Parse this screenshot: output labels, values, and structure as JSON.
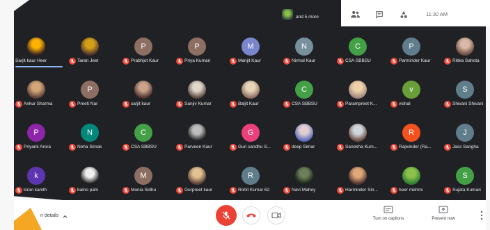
{
  "top_bar": {
    "speakers_summary": "and 5 more",
    "speaker_thumbnail_colors": [
      "#8bc34a",
      "#263238"
    ],
    "clock": "11:30 AM",
    "icons": {
      "participants": "people-icon",
      "chat": "chat-icon",
      "activities": "activities-icon"
    }
  },
  "participants": [
    {
      "name": "Sarjit kaur Heer",
      "photo": [
        "#ffb300",
        "#3e2723"
      ],
      "muted": false,
      "highlighted": true
    },
    {
      "name": "Taran Jeet",
      "photo": [
        "#d4a017",
        "#4e342e"
      ],
      "muted": true
    },
    {
      "name": "Prabhjot Kaur",
      "initial": "P",
      "color": "#8d6e63",
      "muted": true
    },
    {
      "name": "Priya Kumari",
      "initial": "P",
      "color": "#8d6e63",
      "muted": true
    },
    {
      "name": "Manjit Kaur",
      "initial": "M",
      "color": "#7986cb",
      "muted": true
    },
    {
      "name": "Nirmal Kaur",
      "initial": "N",
      "color": "#78909c",
      "muted": true
    },
    {
      "name": "CSA SBBSU",
      "initial": "C",
      "color": "#43a047",
      "muted": true
    },
    {
      "name": "Parminder Kaur",
      "initial": "P",
      "color": "#607d8b",
      "muted": true
    },
    {
      "name": "Ritika Sahota",
      "photo": [
        "#d7b9a7",
        "#6d4c41"
      ],
      "muted": true
    },
    {
      "name": "Ankur Sharma",
      "photo": [
        "#d2a679",
        "#5d4037"
      ],
      "muted": true
    },
    {
      "name": "Preeti Nar",
      "initial": "P",
      "color": "#8d6e63",
      "muted": true
    },
    {
      "name": "sarjit kaur",
      "photo": [
        "#c9a38b",
        "#4e342e"
      ],
      "muted": true
    },
    {
      "name": "Sanjiv Kumar",
      "photo": [
        "#e0d6cc",
        "#5d4b40"
      ],
      "muted": true
    },
    {
      "name": "Baljit Kaur",
      "photo": [
        "#e6d5b8",
        "#8d6e63"
      ],
      "muted": true
    },
    {
      "name": "CSA SBBSU",
      "initial": "C",
      "color": "#43a047",
      "muted": true
    },
    {
      "name": "Parampreet K...",
      "photo": [
        "#f0d2a8",
        "#a1887f"
      ],
      "muted": true
    },
    {
      "name": "vishal",
      "initial": "v",
      "color": "#689f38",
      "muted": true
    },
    {
      "name": "Shivani Shivani",
      "initial": "S",
      "color": "#607d8b",
      "muted": true
    },
    {
      "name": "Priyank Arora",
      "initial": "P",
      "color": "#8e24aa",
      "muted": true
    },
    {
      "name": "Neha Simak",
      "initial": "N",
      "color": "#00897b",
      "muted": true
    },
    {
      "name": "CSA SBBSU",
      "initial": "C",
      "color": "#43a047",
      "muted": true
    },
    {
      "name": "Parveen Kaur",
      "photo": [
        "#bdbdbd",
        "#212121"
      ],
      "muted": true
    },
    {
      "name": "Guri sandhu S...",
      "initial": "G",
      "color": "#ec407a",
      "muted": true
    },
    {
      "name": "deep Simar",
      "photo": [
        "#e0cfcf",
        "#5c6bc0"
      ],
      "muted": true
    },
    {
      "name": "Sanekha Kum...",
      "photo": [
        "#cfd8dc",
        "#6d4c41"
      ],
      "muted": true
    },
    {
      "name": "Rajwinder (Ra...",
      "initial": "R",
      "color": "#f4511e",
      "muted": true
    },
    {
      "name": "Jass Sangha",
      "initial": "J",
      "color": "#607d8b",
      "muted": true
    },
    {
      "name": "kiran kanith",
      "initial": "k",
      "color": "#5e35b1",
      "muted": true
    },
    {
      "name": "balno pahi",
      "photo": [
        "#eeeeee",
        "#1b1b1b"
      ],
      "muted": true
    },
    {
      "name": "Monia Sidhu",
      "initial": "M",
      "color": "#8d6e63",
      "muted": true
    },
    {
      "name": "Gurpreet kaur",
      "photo": [
        "#e2c290",
        "#5d4037"
      ],
      "muted": true
    },
    {
      "name": "Rohit Kumar 62",
      "initial": "R",
      "color": "#607d8b",
      "muted": true
    },
    {
      "name": "Navi Mahey",
      "photo": [
        "#6d7f5a",
        "#1c2418"
      ],
      "muted": true
    },
    {
      "name": "Harminder Sin...",
      "photo": [
        "#e0a878",
        "#4e342e"
      ],
      "muted": true
    },
    {
      "name": "heer mehmi",
      "photo": [
        "#8bc34a",
        "#2e7d32"
      ],
      "muted": true
    },
    {
      "name": "Sujata Kumari",
      "initial": "S",
      "color": "#43a047",
      "muted": true
    }
  ],
  "bottom_bar": {
    "details_label": "n details",
    "details_icon": "chevron-up-icon",
    "mic_icon": "mic-off-icon",
    "end_call_icon": "phone-hangup-icon",
    "camera_icon": "camera-icon",
    "captions_label": "Turn on captions",
    "captions_icon": "captions-icon",
    "present_label": "Present now",
    "present_icon": "present-screen-icon",
    "more_icon": "more-vert-icon"
  },
  "colors": {
    "stage_background": "#202124",
    "speaking_accent": "#8ab4f8",
    "muted_red": "#ea4335",
    "toolbar_background": "#ffffff",
    "toolbar_icon": "#5f6368",
    "frame_orange": "#f5a623"
  }
}
